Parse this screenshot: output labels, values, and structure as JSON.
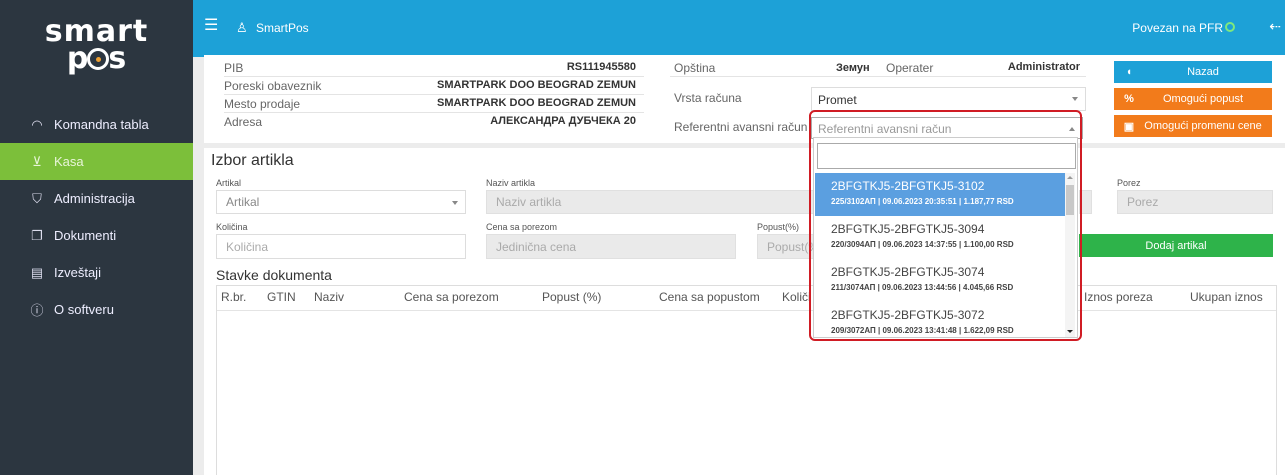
{
  "sidebar": {
    "logo_line1": "smart",
    "logo_line2_a": "p",
    "logo_line2_b": "s",
    "items": [
      {
        "label": "Komandna tabla",
        "icon": "gauge-icon"
      },
      {
        "label": "Kasa",
        "icon": "cart-icon"
      },
      {
        "label": "Administracija",
        "icon": "shield-icon"
      },
      {
        "label": "Dokumenti",
        "icon": "documents-icon"
      },
      {
        "label": "Izveštaji",
        "icon": "reports-icon"
      },
      {
        "label": "O softveru",
        "icon": "info-icon"
      }
    ]
  },
  "topbar": {
    "app_name": "SmartPos",
    "status": "Povezan na PFR",
    "status_color": "#7ee87e",
    "accent": "#1da1d7"
  },
  "info": {
    "rows": [
      {
        "key": "PIB",
        "value": "RS111945580"
      },
      {
        "key": "Poreski obaveznik",
        "value": "SMARTPARK DOO BEOGRAD ZEMUN"
      },
      {
        "key": "Mesto prodaje",
        "value": "SMARTPARK DOO BEOGRAD ZEMUN"
      },
      {
        "key": "Adresa",
        "value": "АЛЕКСАНДРА ДУБЧЕКА 20"
      }
    ],
    "opstina_label": "Opština",
    "opstina_value": "Земун",
    "operater_label": "Operater",
    "operater_value": "Administrator",
    "vrsta_label": "Vrsta računa",
    "vrsta_value": "Promet",
    "ref_label": "Referentni avansni račun",
    "ref_placeholder": "Referentni avansni račun"
  },
  "actions": {
    "back": "Nazad",
    "discount": "Omogući popust",
    "price_change": "Omogući promenu cene",
    "back_color": "#1da1d7",
    "orange_color": "#f27b1b"
  },
  "item_form": {
    "title": "Izbor artikla",
    "artikal_label": "Artikal",
    "artikal_placeholder": "Artikal",
    "naziv_label": "Naziv artikla",
    "naziv_placeholder": "Naziv artikla",
    "porez_label": "Porez",
    "porez_placeholder": "Porez",
    "kolicina_label": "Količina",
    "kolicina_placeholder": "Količina",
    "cena_label": "Cena sa porezom",
    "cena_placeholder": "Jedinična cena",
    "popust_label": "Popust(%)",
    "popust_placeholder": "Popust(%",
    "add_button": "Dodaj artikal"
  },
  "table": {
    "title": "Stavke dokumenta",
    "columns": [
      "R.br.",
      "GTIN",
      "Naziv",
      "Cena sa porezom",
      "Popust (%)",
      "Cena sa popustom",
      "Količi",
      "Iznos poreza",
      "Ukupan iznos"
    ]
  },
  "dropdown": {
    "items": [
      {
        "title": "2BFGTKJ5-2BFGTKJ5-3102",
        "sub": "225/3102АП | 09.06.2023 20:35:51 | 1.187,77 RSD"
      },
      {
        "title": "2BFGTKJ5-2BFGTKJ5-3094",
        "sub": "220/3094АП | 09.06.2023 14:37:55 | 1.100,00 RSD"
      },
      {
        "title": "2BFGTKJ5-2BFGTKJ5-3074",
        "sub": "211/3074АП | 09.06.2023 13:44:56 | 4.045,66 RSD"
      },
      {
        "title": "2BFGTKJ5-2BFGTKJ5-3072",
        "sub": "209/3072АП | 09.06.2023 13:41:48 | 1.622,09 RSD"
      }
    ],
    "selected_index": 0,
    "highlight_color": "#d01c24"
  }
}
